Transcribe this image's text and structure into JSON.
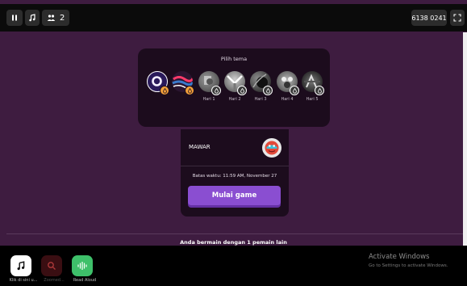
{
  "topbar": {
    "players_count": "2",
    "game_code": "6138 0241"
  },
  "themes": {
    "title": "Pilih tema",
    "items": [
      {
        "label": "",
        "colors": [
          "#c8c8ff",
          "#2a1a5a"
        ]
      },
      {
        "label": "",
        "colors": [
          "#ff3a6a",
          "#3a7acc"
        ]
      },
      {
        "label": "Hari 1",
        "colors": [
          "#9a9a9a",
          "#4a4a4a"
        ]
      },
      {
        "label": "Hari 2",
        "colors": [
          "#d0d0d0",
          "#5a5a5a"
        ]
      },
      {
        "label": "Hari 3",
        "colors": [
          "#8a8a8a",
          "#222222"
        ]
      },
      {
        "label": "Hari 4",
        "colors": [
          "#bbbbbb",
          "#555555"
        ]
      },
      {
        "label": "Hari 5",
        "colors": [
          "#777777",
          "#1a1a1a"
        ]
      }
    ]
  },
  "player": {
    "name": "MAWAR"
  },
  "deadline": "Batas waktu: 11:59 AM, November 27",
  "start_button": "Mulai game",
  "players_note": "Anda bermain dengan 1 pemain lain",
  "taskbar": {
    "apps": [
      {
        "label": "Klik di sini u...",
        "icon": "music-note-icon",
        "bg": "#ffffff"
      },
      {
        "label": "Zoomed...",
        "icon": "search-icon",
        "bg": "#5a1a1a"
      },
      {
        "label": "Read Aloud",
        "icon": "sound-wave-icon",
        "bg": "#3ec06a"
      }
    ]
  },
  "windows_watermark": {
    "title": "Activate Windows",
    "subtitle": "Go to Settings to activate Windows."
  },
  "colors": {
    "background": "#3e1c40",
    "card": "#1c0c1d",
    "accent": "#8a4ed1",
    "badge": "#f2a03a"
  }
}
